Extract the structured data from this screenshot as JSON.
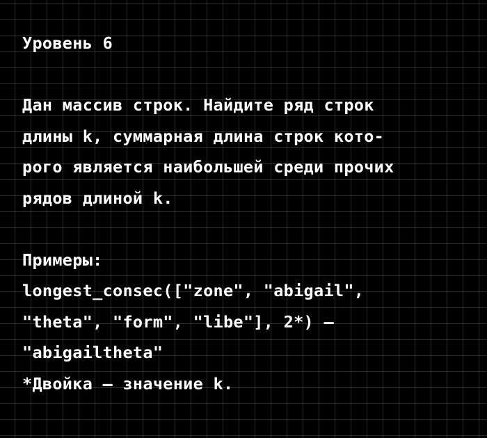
{
  "level_title": "Уровень 6",
  "task": {
    "lines": [
      "Дан массив строк. Найдите ряд строк",
      "длины k, суммарная длина строк кото-",
      "рого является наибольшей среди прочих",
      "рядов длиной k."
    ]
  },
  "examples": {
    "heading": "Примеры:",
    "lines": [
      "longest_consec([\"zone\", \"abigail\",",
      "\"theta\", \"form\", \"libe\"], 2*) —",
      "\"abigailtheta\"",
      "*Двойка — значение k."
    ]
  },
  "colors": {
    "background": "#000000",
    "text": "#ffffff",
    "grid": "#3a3a3a"
  }
}
